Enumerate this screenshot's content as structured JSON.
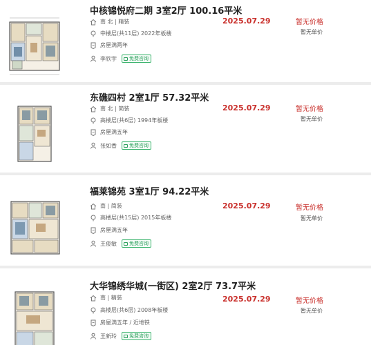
{
  "listings": [
    {
      "title": "中核锦悦府二期 3室2厅 100.16平米",
      "orientation": "南 北 | 精装",
      "floor": "中楼层(共11层) 2022年板楼",
      "tag_line": "房屋满两年",
      "agent": "李欣宇",
      "consult": "免费咨询",
      "date": "2025.07.29",
      "price": "暂无价格",
      "unit_price": "暂无单价"
    },
    {
      "title": "东礁四村 2室1厅 57.32平米",
      "orientation": "南 北 | 简装",
      "floor": "高楼层(共6层) 1994年板楼",
      "tag_line": "房屋满五年",
      "agent": "张如香",
      "consult": "免费咨询",
      "date": "2025.07.29",
      "price": "暂无价格",
      "unit_price": "暂无单价"
    },
    {
      "title": "福莱锦苑 3室1厅 94.22平米",
      "orientation": "南 | 简装",
      "floor": "高楼层(共15层) 2015年板楼",
      "tag_line": "房屋满五年",
      "agent": "王俊敏",
      "consult": "免费咨询",
      "date": "2025.07.29",
      "price": "暂无价格",
      "unit_price": "暂无单价"
    },
    {
      "title": "大华锦绣华城(一街区) 2室2厅 73.7平米",
      "orientation": "南 | 精装",
      "floor": "高楼层(共6层) 2008年板楼",
      "tag_line": "房屋满五年 / 近地铁",
      "agent": "王新玲",
      "consult": "免费咨询",
      "date": "2025.07.29",
      "price": "暂无价格",
      "unit_price": "暂无单价"
    }
  ],
  "icons": {
    "orientation": "house-icon",
    "floor": "location-pin-icon",
    "tag": "certificate-icon",
    "agent": "person-icon"
  },
  "colors": {
    "accent_red": "#c9302c",
    "consult_green": "#2fa15f"
  }
}
